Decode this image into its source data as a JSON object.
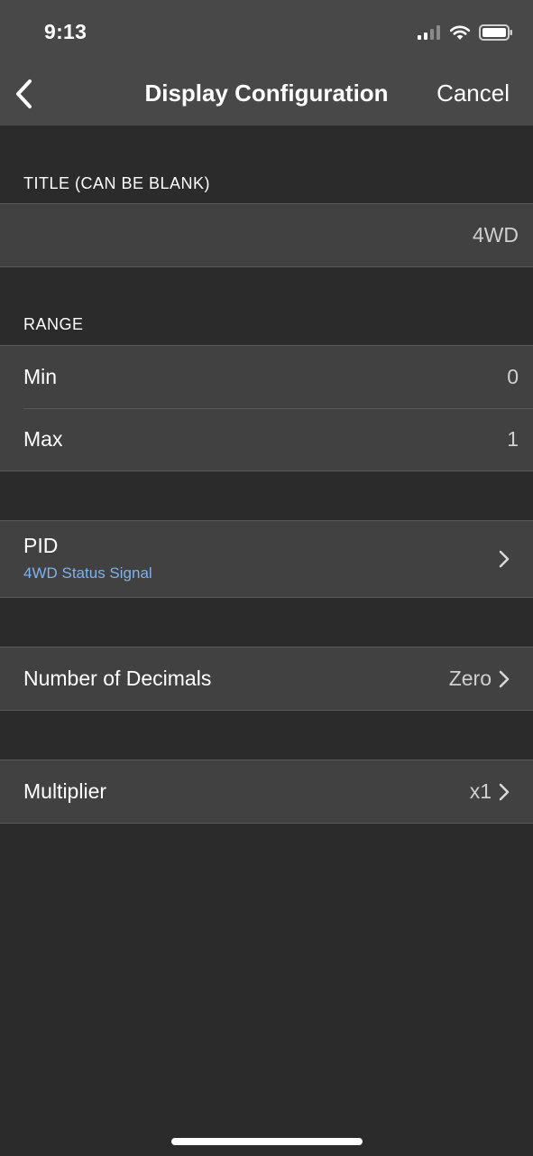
{
  "status_bar": {
    "time": "9:13",
    "icons": [
      "signal-icon",
      "wifi-icon",
      "battery-icon"
    ]
  },
  "nav": {
    "back_icon": "chevron-left-icon",
    "title": "Display Configuration",
    "cancel_label": "Cancel"
  },
  "title_section": {
    "header": "TITLE (CAN BE BLANK)",
    "value": "4WD"
  },
  "range_section": {
    "header": "RANGE",
    "rows": [
      {
        "label": "Min",
        "value": "0"
      },
      {
        "label": "Max",
        "value": "1"
      }
    ]
  },
  "pid": {
    "label": "PID",
    "subtitle": "4WD Status Signal"
  },
  "decimals": {
    "label": "Number of Decimals",
    "value": "Zero"
  },
  "multiplier": {
    "label": "Multiplier",
    "value": "x1"
  },
  "colors": {
    "nav_background": "#484848",
    "page_background": "#2b2b2b",
    "cell_background": "#414141",
    "subtitle_accent": "#7fb1ec"
  }
}
